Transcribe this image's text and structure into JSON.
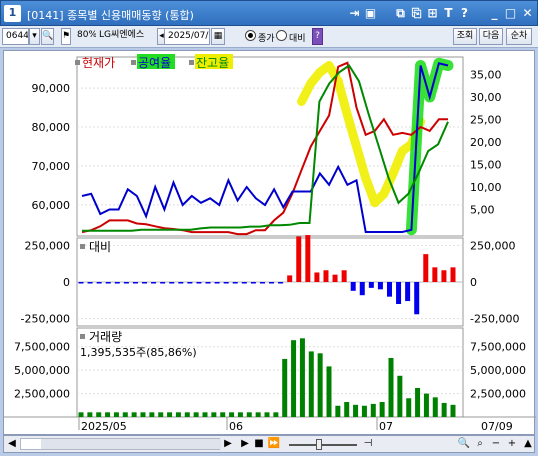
{
  "window": {
    "number": "1",
    "title": "[0141] 종목별 신용매매동향 (통합)"
  },
  "toolbar": {
    "code": "0644",
    "market_flag": "80%",
    "stock_name": "LG씨엔에스",
    "date": "2025/07/",
    "radio1": "종가",
    "radio2": "대비",
    "help": "?",
    "btn_query": "조회",
    "btn_next": "다음",
    "btn_order": "순차"
  },
  "chart_data": [
    {
      "type": "line",
      "legend": [
        "현재가",
        "공여율",
        "잔고율"
      ],
      "left_ticks": [
        "90,000",
        "80,000",
        "70,000",
        "60,000"
      ],
      "right_ticks": [
        "35,00",
        "30,00",
        "25,00",
        "20,00",
        "15,00",
        "10,00",
        "5,00"
      ],
      "ylim_left": [
        52000,
        98000
      ],
      "ylim_right": [
        0,
        38
      ],
      "series": [
        {
          "name": "현재가",
          "color": "#cc0000",
          "axis": "left",
          "values": [
            53000,
            53500,
            54500,
            56000,
            56000,
            56000,
            55200,
            55000,
            54500,
            54000,
            53800,
            53500,
            53000,
            53000,
            53000,
            53000,
            53000,
            52500,
            52500,
            53500,
            53500,
            56000,
            58000,
            63000,
            69000,
            75000,
            79000,
            83000,
            95500,
            96500,
            85000,
            78000,
            79000,
            82000,
            78000,
            78500,
            78000,
            80000,
            79000,
            82000,
            82000
          ]
        },
        {
          "name": "공여율",
          "color": "#0000cc",
          "axis": "right",
          "values": [
            8,
            8.5,
            4,
            5,
            5,
            9.5,
            8,
            3.5,
            10,
            5,
            11,
            6,
            8,
            6.5,
            7.5,
            6,
            11.5,
            7,
            10,
            7.5,
            6,
            9.5,
            5.5,
            9,
            9,
            9,
            13,
            10.5,
            14.5,
            10.5,
            11.5,
            0,
            0,
            0,
            0,
            0,
            0.5,
            37,
            30,
            37.5,
            37
          ]
        },
        {
          "name": "잔고율",
          "color": "#008800",
          "axis": "right",
          "values": [
            0.3,
            0.3,
            0.3,
            0.3,
            0.3,
            0.3,
            0.5,
            0.5,
            0.5,
            0.5,
            0.5,
            0.5,
            0.8,
            1,
            1,
            1,
            1,
            1.2,
            1.2,
            1.5,
            1.5,
            1.6,
            2,
            2,
            29,
            33,
            35.5,
            37,
            33.5,
            26,
            19,
            12,
            6.5,
            8.5,
            13,
            18,
            19.5,
            24.5
          ]
        }
      ]
    },
    {
      "type": "bar",
      "label": "대비",
      "ticks": [
        "250,000",
        "0",
        "-250,000"
      ],
      "ylim": [
        -300000,
        300000
      ],
      "values": [
        -2000,
        -4000,
        -3000,
        -2000,
        -3000,
        -2000,
        -3000,
        -3000,
        -2000,
        -3000,
        -3000,
        -2000,
        -3000,
        -2000,
        -3000,
        -3000,
        -2000,
        -3000,
        -2000,
        -3000,
        -2000,
        -3000,
        -4000,
        45000,
        310000,
        320000,
        65000,
        80000,
        50000,
        80000,
        -60000,
        -90000,
        -40000,
        -50000,
        -100000,
        -150000,
        -130000,
        -220000,
        190000,
        100000,
        80000,
        100000
      ]
    },
    {
      "type": "bar",
      "label": "거래량",
      "value_text": "1,395,535주(85,86%)",
      "ticks": [
        "7,500,000",
        "5,000,000",
        "2,500,000"
      ],
      "ylim": [
        0,
        9500000
      ],
      "values": [
        500000,
        500000,
        500000,
        500000,
        500000,
        500000,
        500000,
        500000,
        500000,
        500000,
        500000,
        500000,
        500000,
        500000,
        500000,
        500000,
        500000,
        500000,
        500000,
        500000,
        500000,
        500000,
        500000,
        6200000,
        8200000,
        8400000,
        7000000,
        6800000,
        5400000,
        1200000,
        1600000,
        1300000,
        1200000,
        1400000,
        1600000,
        6300000,
        4400000,
        2000000,
        3100000,
        2500000,
        2100000,
        1500000,
        1300000
      ]
    }
  ],
  "x_axis": [
    "2025/05",
    "06",
    "07"
  ],
  "x_right_label": "07/09",
  "colors": {
    "title_bg": "#3a7bcb",
    "price": "#cc0000",
    "supply": "#0000cc",
    "balance": "#008800",
    "up_bar": "#ee0000",
    "down_bar": "#0000ee",
    "volume_bar": "#008000",
    "highlight_yellow": "#f0ee00",
    "highlight_green": "#22dd22"
  }
}
